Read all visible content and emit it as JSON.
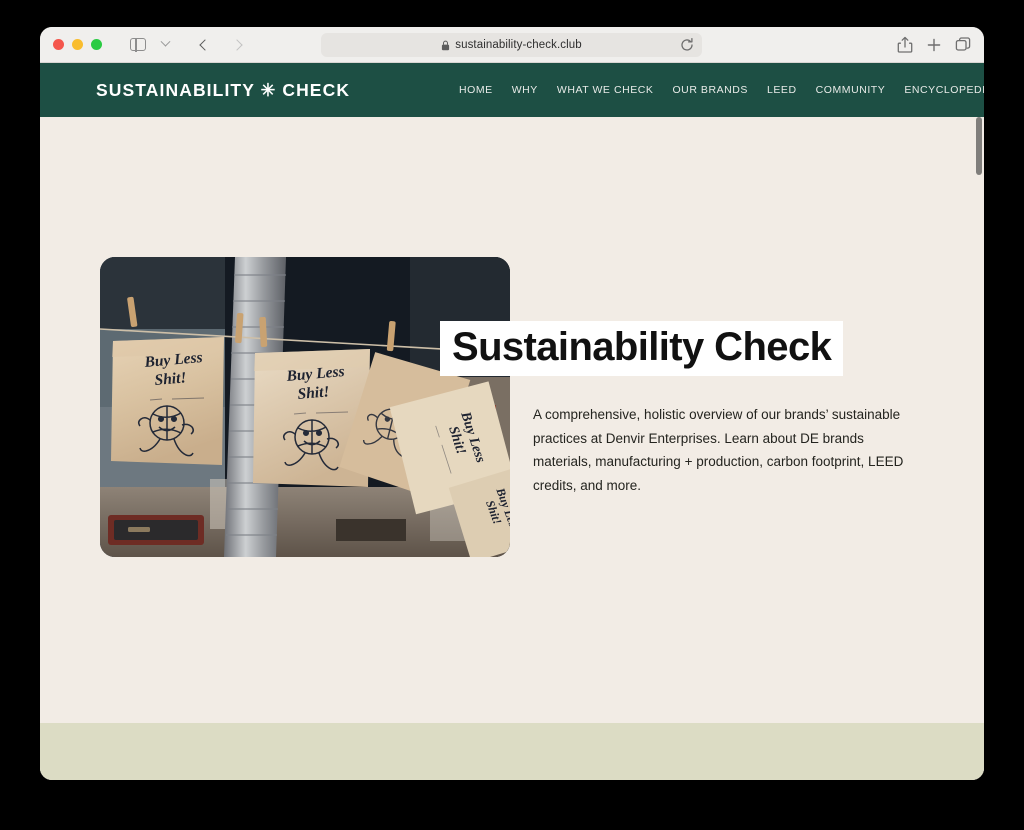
{
  "browser": {
    "traffic_lights": [
      {
        "name": "close",
        "color": "#f4564c"
      },
      {
        "name": "minimize",
        "color": "#f9bd2e"
      },
      {
        "name": "maximize",
        "color": "#2acb42"
      }
    ],
    "sidebar_toggle_icon": "sidebar-icon",
    "tab_overview_chevron_icon": "chevron-down-icon",
    "back_icon": "chevron-left-icon",
    "forward_icon": "chevron-right-icon",
    "address": {
      "lock_icon": "lock-icon",
      "url": "sustainability-check.club",
      "reload_icon": "reload-icon"
    },
    "actions": [
      {
        "name": "share-icon",
        "label": "Share"
      },
      {
        "name": "plus-icon",
        "label": "New Tab"
      },
      {
        "name": "tabs-icon",
        "label": "Show Tab Overview"
      }
    ]
  },
  "site": {
    "logo": "SUSTAINABILITY ✳ CHECK",
    "nav": [
      {
        "label": "HOME"
      },
      {
        "label": "WHY"
      },
      {
        "label": "WHAT WE CHECK"
      },
      {
        "label": "OUR BRANDS"
      },
      {
        "label": "LEED"
      },
      {
        "label": "COMMUNITY"
      },
      {
        "label": "ENCYCLOPEDIA"
      }
    ],
    "hero": {
      "image_alt": "Kraft paper bags printed 'Buy Less Shit!' hanging on a clothesline with wooden clothespins",
      "bag_text_line1": "Buy Less",
      "bag_text_line2": "Shit!",
      "title": "Sustainability Check",
      "paragraph": "A comprehensive, holistic overview of our brands’ sustainable practices at Denvir Enterprises. Learn about DE brands materials, manufacturing + production, carbon footprint, LEED credits, and more."
    }
  },
  "colors": {
    "header_green": "#1d4f44",
    "page_background": "#f2ece5",
    "bottom_band": "#dcdcc4",
    "title_block": "#ffffff",
    "text": "#24241f"
  }
}
